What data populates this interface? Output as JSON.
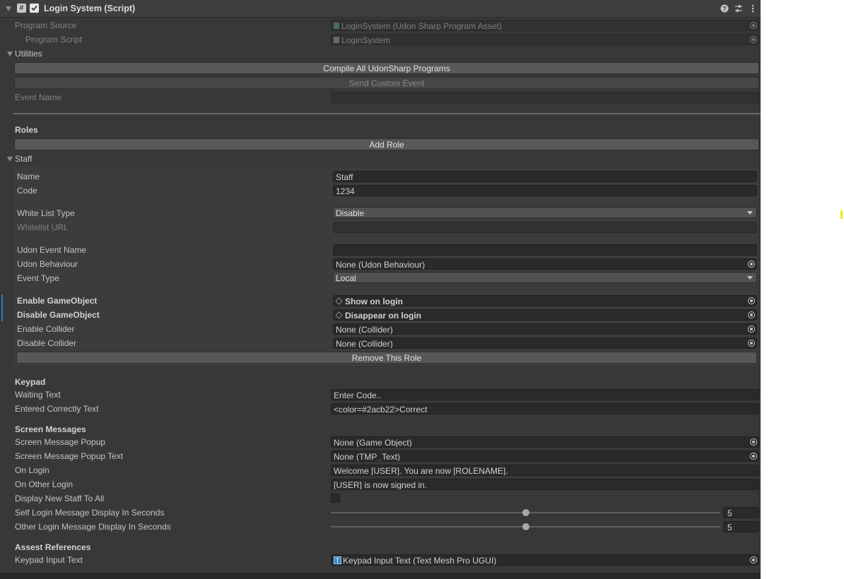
{
  "header": {
    "title": "Login System (Script)",
    "enabled": true,
    "script_glyph": "#",
    "help_icon": "help-icon",
    "presets_icon": "presets-icon",
    "menu_icon": "kebab-menu-icon"
  },
  "program": {
    "source_label": "Program Source",
    "source_value": "LoginSystem (Udon Sharp Program Asset)",
    "script_label": "Program Script",
    "script_value": "LoginSystem"
  },
  "utilities": {
    "label": "Utilities",
    "compile_btn": "Compile All UdonSharp Programs",
    "send_event_btn": "Send Custom Event",
    "event_name_label": "Event Name",
    "event_name_value": ""
  },
  "roles": {
    "heading": "Roles",
    "add_btn": "Add Role",
    "role": {
      "foldout": "Staff",
      "name_label": "Name",
      "name_value": "Staff",
      "code_label": "Code",
      "code_value": "1234",
      "whitelist_type_label": "White List Type",
      "whitelist_type_value": "Disable",
      "whitelist_url_label": "Whitelist URL",
      "whitelist_url_value": "",
      "udon_event_label": "Udon Event Name",
      "udon_event_value": "",
      "udon_behaviour_label": "Udon Behaviour",
      "udon_behaviour_value": "None (Udon Behaviour)",
      "event_type_label": "Event Type",
      "event_type_value": "Local",
      "enable_go_label": "Enable GameObject",
      "enable_go_value": "Show on login",
      "disable_go_label": "Disable GameObject",
      "disable_go_value": "Disappear on login",
      "enable_col_label": "Enable Collider",
      "enable_col_value": "None (Collider)",
      "disable_col_label": "Disable Collider",
      "disable_col_value": "None (Collider)",
      "remove_btn": "Remove This Role"
    }
  },
  "keypad": {
    "heading": "Keypad",
    "waiting_label": "Waiting Text",
    "waiting_value": "Enter Code..",
    "correct_label": "Entered Correctly Text",
    "correct_value": "<color=#2acb22>Correct"
  },
  "screen_messages": {
    "heading": "Screen Messages",
    "popup_label": "Screen Message Popup",
    "popup_value": "None (Game Object)",
    "popup_text_label": "Screen Message Popup Text",
    "popup_text_value": "None (TMP_Text)",
    "on_login_label": "On Login",
    "on_login_value": "Welcome [USER]. You are now [ROLENAME].",
    "on_other_label": "On Other Login",
    "on_other_value": "[USER] is now signed in.",
    "display_new_label": "Display New Staff To All",
    "display_new_checked": false,
    "self_seconds_label": "Self Login Message Display In Seconds",
    "self_seconds_value": "5",
    "self_seconds_fraction": 0.5,
    "other_seconds_label": "Other Login Message Display In Seconds",
    "other_seconds_value": "5",
    "other_seconds_fraction": 0.5
  },
  "references": {
    "heading": "Assest References",
    "keypad_input_label": "Keypad Input Text",
    "keypad_input_value": "Keypad Input Text (Text Mesh Pro UGUI)",
    "tmp_glyph": "T"
  },
  "colors": {
    "panel": "#383838",
    "field": "#2a2a2a",
    "button": "#585858",
    "highlight_marker": "#f2e600"
  }
}
